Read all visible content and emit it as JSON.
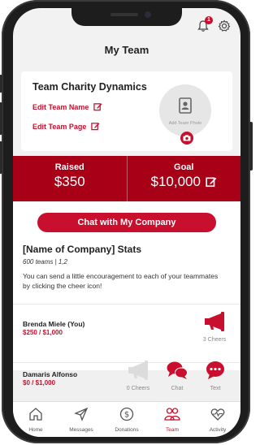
{
  "header": {
    "title": "My Team",
    "notification_count": "1"
  },
  "team": {
    "name": "Team Charity Dynamics",
    "edit_name_label": "Edit Team Name",
    "edit_page_label": "Edit Team Page",
    "photo_label": "Add Team Photo"
  },
  "stats": {
    "raised_label": "Raised",
    "raised_value": "$350",
    "goal_label": "Goal",
    "goal_value": "$10,000"
  },
  "company": {
    "chat_button": "Chat with My Company",
    "stats_title": "[Name of Company] Stats",
    "teams_line": "600 teams | 1,2",
    "encouragement": "You can send a little encouragement to each of your teammates by clicking the cheer icon!"
  },
  "members": [
    {
      "name": "Brenda Miele (You)",
      "amount": "$250 / $1,000",
      "cheers": "3 Cheers"
    },
    {
      "name": "Damaris Alfonso",
      "amount": "$0 / $1,000",
      "cheers": "0 Cheers",
      "chat": "Chat",
      "text": "Text"
    }
  ],
  "nav": [
    {
      "label": "Home",
      "icon": "home-icon"
    },
    {
      "label": "Messages",
      "icon": "send-icon"
    },
    {
      "label": "Donations",
      "icon": "dollar-icon"
    },
    {
      "label": "Team",
      "icon": "team-icon",
      "active": true
    },
    {
      "label": "Activity",
      "icon": "heart-pulse-icon"
    }
  ],
  "colors": {
    "accent": "#c8102e",
    "stats_bar": "#a80016"
  }
}
